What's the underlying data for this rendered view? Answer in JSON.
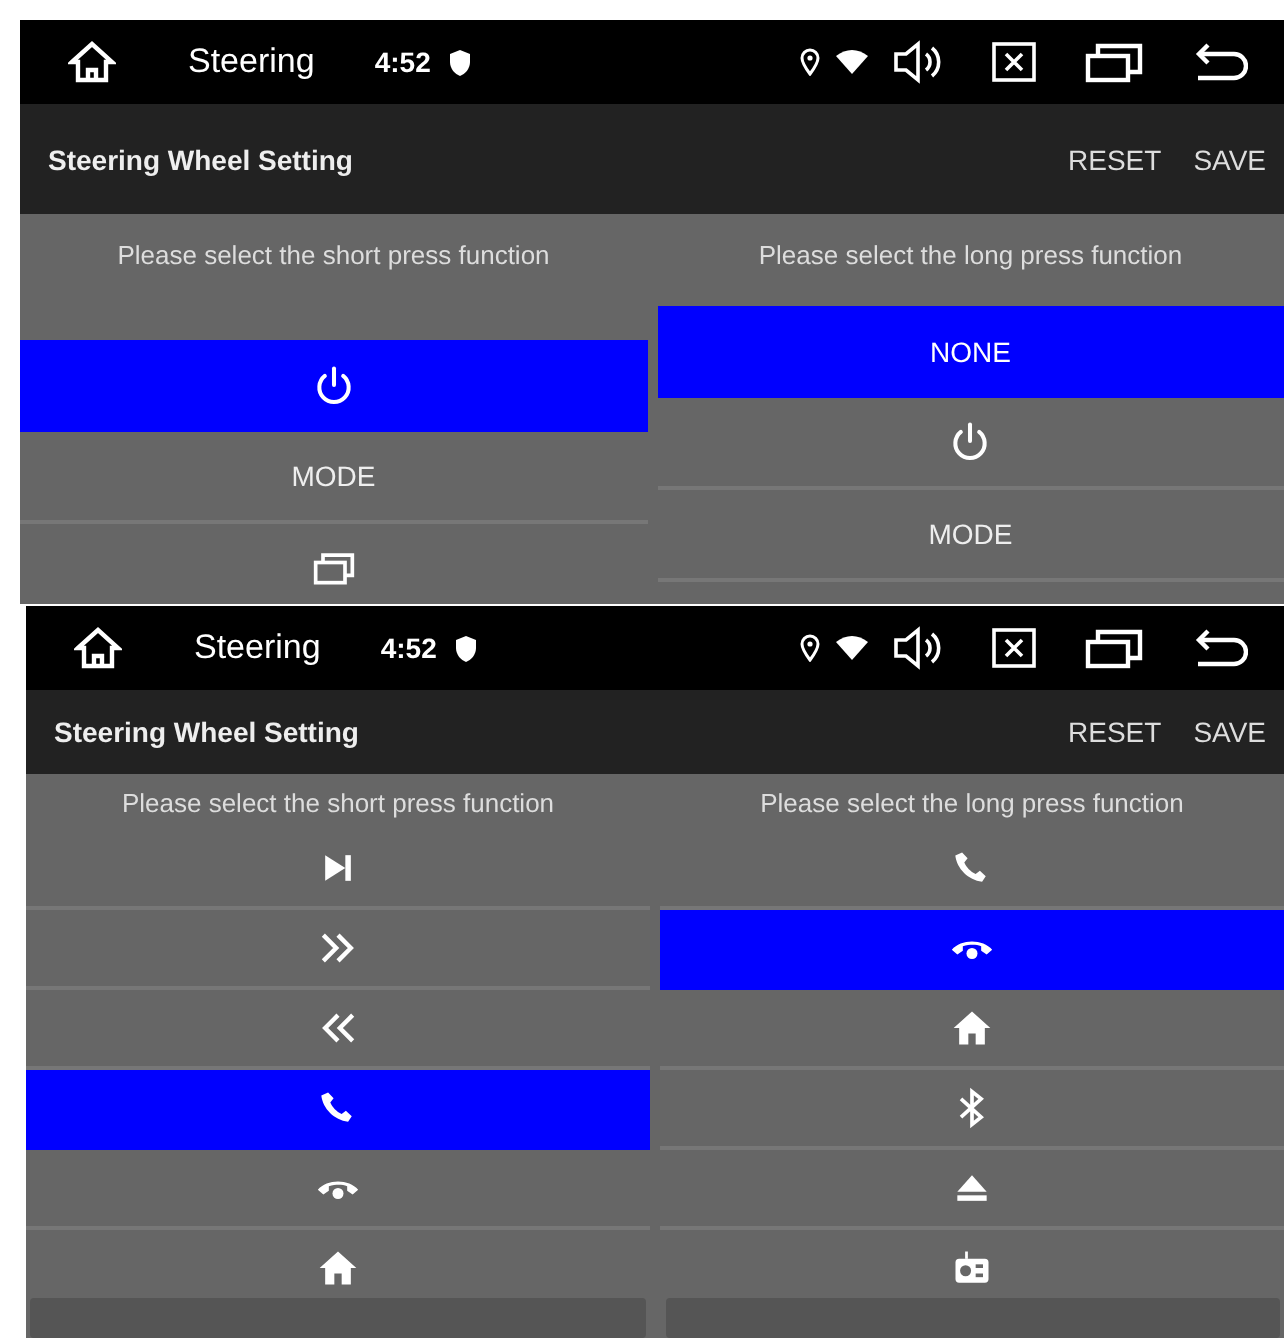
{
  "screens": [
    {
      "status_bar": {
        "title": "Steering",
        "time": "4:52"
      },
      "header": {
        "title": "Steering Wheel Setting",
        "actions": [
          "RESET",
          "SAVE"
        ]
      },
      "columns": [
        {
          "prompt": "Please select the short press function",
          "items": [
            {
              "kind": "power",
              "selected": true
            },
            {
              "kind": "text",
              "label": "MODE",
              "selected": false
            },
            {
              "kind": "windows",
              "selected": false
            }
          ]
        },
        {
          "prompt": "Please select the long press function",
          "items": [
            {
              "kind": "text",
              "label": "NONE",
              "selected": true
            },
            {
              "kind": "power",
              "selected": false
            },
            {
              "kind": "text",
              "label": "MODE",
              "selected": false
            }
          ]
        }
      ],
      "has_dialog_buttons": false
    },
    {
      "status_bar": {
        "title": "Steering",
        "time": "4:52"
      },
      "header": {
        "title": "Steering Wheel Setting",
        "actions": [
          "RESET",
          "SAVE"
        ]
      },
      "columns": [
        {
          "prompt": "Please select the short press function",
          "items": [
            {
              "kind": "skip-next",
              "selected": false
            },
            {
              "kind": "forward",
              "selected": false
            },
            {
              "kind": "rewind",
              "selected": false
            },
            {
              "kind": "phone",
              "selected": true
            },
            {
              "kind": "hang-up",
              "selected": false
            },
            {
              "kind": "home",
              "selected": false
            }
          ]
        },
        {
          "prompt": "Please select the long press function",
          "items": [
            {
              "kind": "phone",
              "selected": false
            },
            {
              "kind": "hang-up",
              "selected": true
            },
            {
              "kind": "home",
              "selected": false
            },
            {
              "kind": "bluetooth",
              "selected": false
            },
            {
              "kind": "eject",
              "selected": false
            },
            {
              "kind": "radio",
              "selected": false
            }
          ]
        }
      ],
      "has_dialog_buttons": true
    }
  ]
}
